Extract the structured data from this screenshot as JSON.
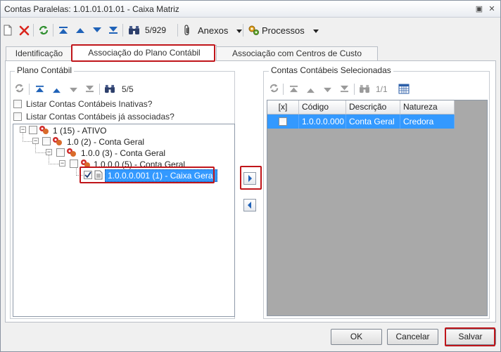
{
  "window": {
    "title": "Contas Paralelas: 1.01.01.01.01 - Caixa Matriz",
    "restore_glyph": "▣",
    "close_glyph": "✕"
  },
  "toolbar": {
    "record_counter": "5/929",
    "anexos_label": "Anexos",
    "processos_label": "Processos"
  },
  "tabs": [
    {
      "label": "Identificação",
      "active": false
    },
    {
      "label": "Associação do Plano Contábil",
      "active": true
    },
    {
      "label": "Associação com Centros de Custo",
      "active": false
    }
  ],
  "plano": {
    "title": "Plano Contábil",
    "counter": "5/5",
    "option_inativas": "Listar Contas Contábeis Inativas?",
    "option_associadas": "Listar Contas Contábeis já associadas?",
    "tree": [
      {
        "label": "1 (15) - ATIVO",
        "checked": false
      },
      {
        "label": "1.0 (2) - Conta Geral",
        "checked": false
      },
      {
        "label": "1.0.0 (3) - Conta Geral",
        "checked": false
      },
      {
        "label": "1.0.0.0 (5) - Conta Geral",
        "checked": false
      },
      {
        "label": "1.0.0.0.001 (1) - Caixa Geral",
        "checked": true
      }
    ]
  },
  "selecionadas": {
    "title": "Contas Contábeis Selecionadas",
    "counter": "1/1",
    "columns": [
      "[x]",
      "Código",
      "Descrição",
      "Natureza"
    ],
    "rows": [
      {
        "codigo": "1.0.0.0.000",
        "descricao": "Conta Geral",
        "natureza": "Credora"
      }
    ]
  },
  "footer": {
    "ok": "OK",
    "cancelar": "Cancelar",
    "salvar": "Salvar"
  },
  "colors": {
    "selection": "#3399ff",
    "highlight_border": "#c0151a"
  },
  "icons": [
    "new-icon",
    "delete-icon",
    "refresh-icon",
    "first-icon",
    "previous-icon",
    "next-icon",
    "last-icon",
    "binoculars-icon",
    "paperclip-icon",
    "processes-icon",
    "calendar-grid-icon"
  ]
}
